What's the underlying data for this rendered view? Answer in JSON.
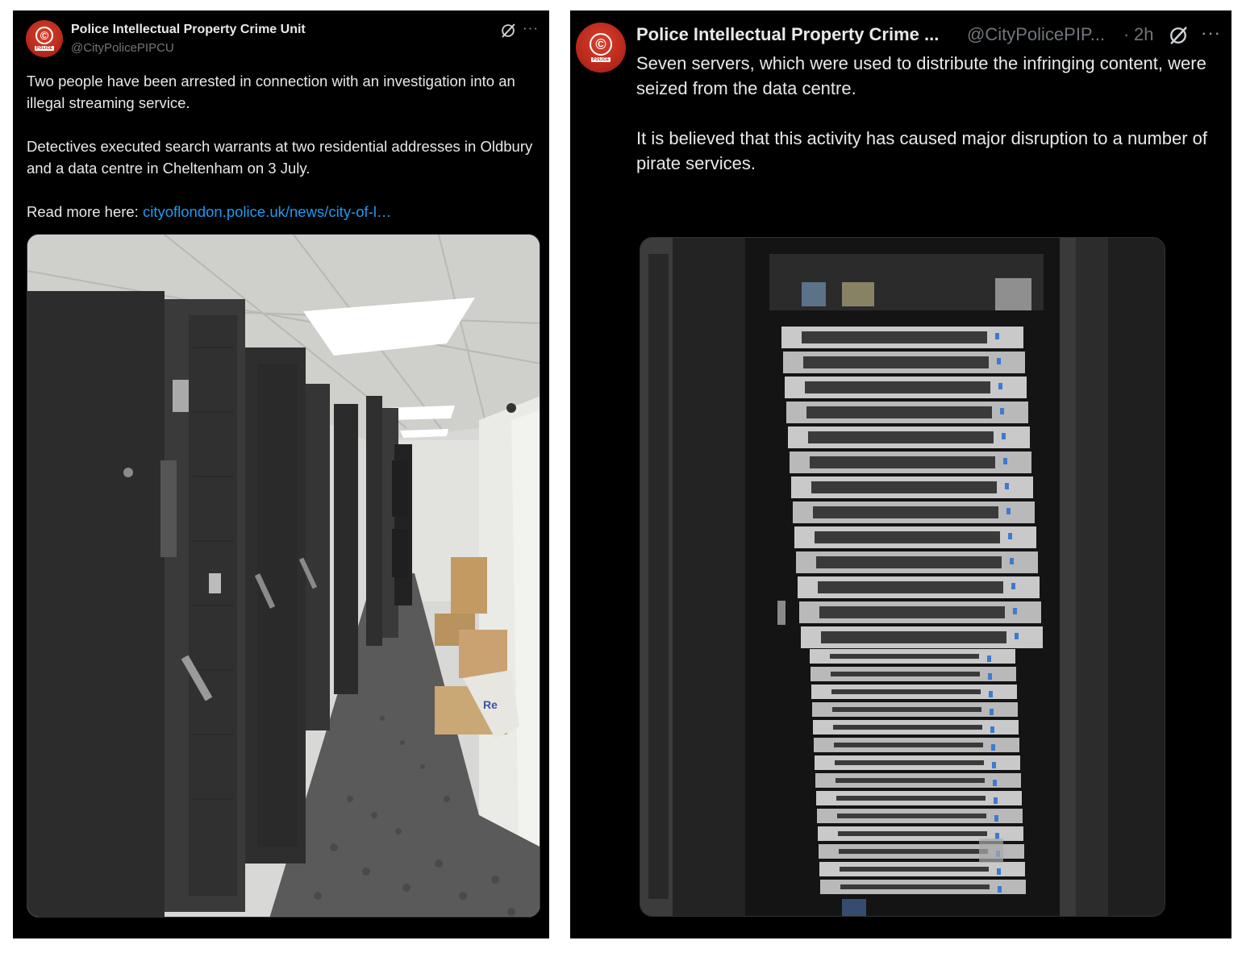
{
  "left_post": {
    "author_name": "Police Intellectual Property Crime Unit",
    "author_handle": "@CityPolicePIPCU",
    "avatar_text": "POLICE",
    "paragraphs": [
      "Two people have been arrested in connection with an investigation into an illegal streaming service.",
      "Detectives executed search warrants at two residential addresses in Oldbury and a data centre in Cheltenham on 3 July."
    ],
    "read_more_label": "Read more here: ",
    "link_text": "cityoflondon.police.uk/news/city-of-l…",
    "more_icon": "···",
    "grok_icon": "grok-icon",
    "photo_bag_text": "Re"
  },
  "right_post": {
    "author_name": "Police Intellectual Property Crime ...",
    "author_handle": "@CityPolicePIP...",
    "separator": "·",
    "time": "2h",
    "avatar_text": "POLICE",
    "paragraphs": [
      "Seven servers, which were used to distribute the infringing content, were seized from the data centre.",
      "It is believed that this activity has caused major disruption to a number of pirate services."
    ],
    "more_icon": "···",
    "grok_icon": "grok-icon"
  },
  "colors": {
    "background": "#000000",
    "text": "#e7e9ea",
    "secondary_text": "#71767b",
    "link": "#1d9bf0",
    "avatar": "#b3261a"
  }
}
